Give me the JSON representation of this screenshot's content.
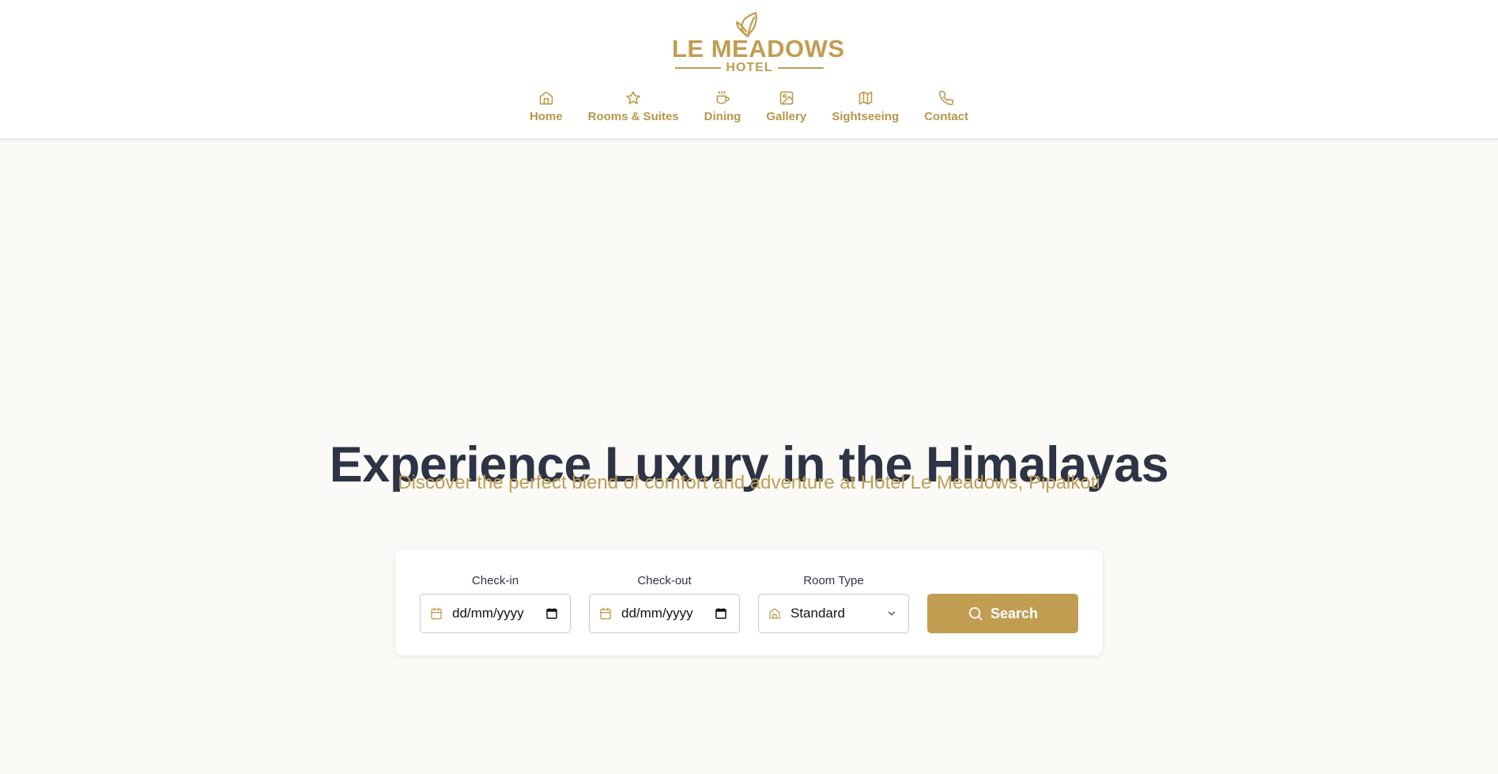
{
  "brand": {
    "name_line1": "LE MEADOWS",
    "name_line2": "HOTEL",
    "color": "#c19d52",
    "logo_icon": "leaf-icon"
  },
  "nav": {
    "items": [
      {
        "label": "Home",
        "icon": "home-icon"
      },
      {
        "label": "Rooms & Suites",
        "icon": "star-icon"
      },
      {
        "label": "Dining",
        "icon": "coffee-icon"
      },
      {
        "label": "Gallery",
        "icon": "image-icon"
      },
      {
        "label": "Sightseeing",
        "icon": "map-icon"
      },
      {
        "label": "Contact",
        "icon": "phone-icon"
      }
    ]
  },
  "hero": {
    "title": "Experience Luxury in the Himalayas",
    "subtitle": "Discover the perfect blend of comfort and adventure at Hotel Le Meadows, Pipalkoti",
    "title_color": "#2d3446"
  },
  "booking": {
    "checkin": {
      "label": "Check-in",
      "value": "dd/mm/yyyy",
      "icon": "calendar-icon"
    },
    "checkout": {
      "label": "Check-out",
      "value": "dd/mm/yyyy",
      "icon": "calendar-icon"
    },
    "room_type": {
      "label": "Room Type",
      "value": "Standard",
      "icon": "building-icon"
    },
    "search_label": "Search",
    "search_icon": "search-icon",
    "accent_color": "#c19d52"
  }
}
